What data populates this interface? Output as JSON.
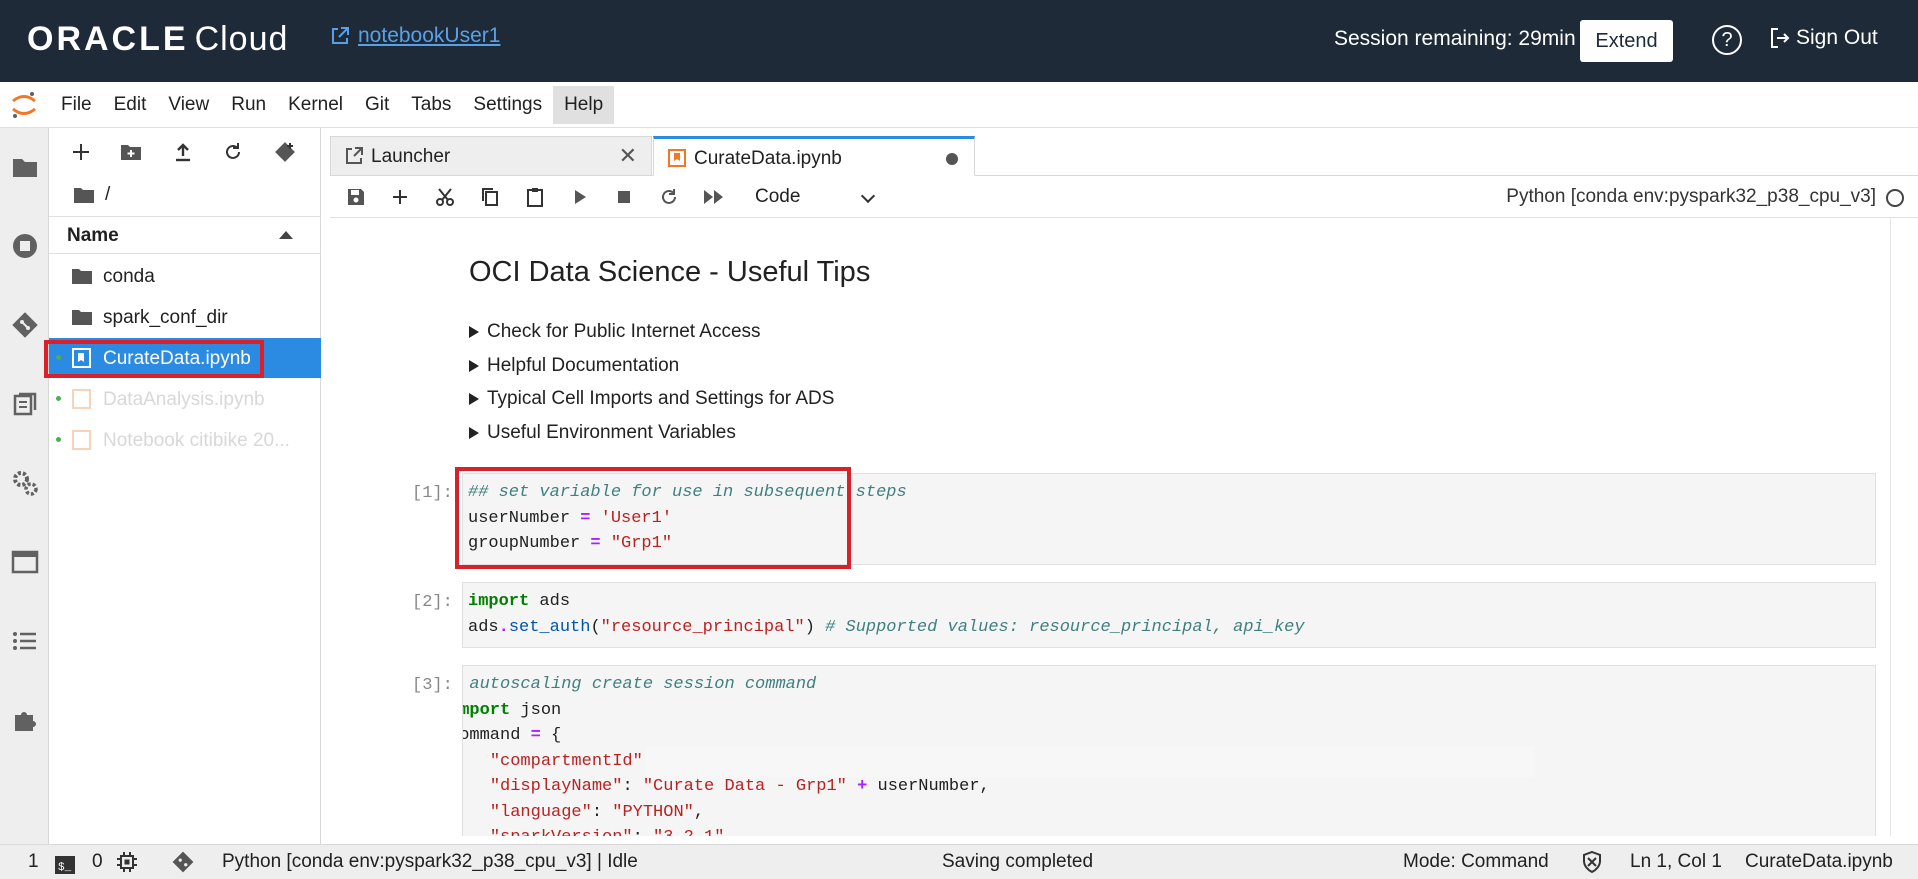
{
  "header": {
    "brand_bold": "ORACLE",
    "brand_light": "Cloud",
    "notebook_link": "notebookUser1",
    "session_text": "Session remaining: 29min",
    "extend_label": "Extend",
    "help_label": "?",
    "signout_label": "Sign Out",
    "bg_color": "#1f2a38"
  },
  "menubar": {
    "items": [
      "File",
      "Edit",
      "View",
      "Run",
      "Kernel",
      "Git",
      "Tabs",
      "Settings",
      "Help"
    ],
    "active": "Help"
  },
  "sidebar_icons": [
    "folder-icon",
    "running-icon",
    "git-icon",
    "property-inspector-icon",
    "settings-icon",
    "tabs-icon",
    "toc-icon",
    "extension-icon"
  ],
  "file_browser": {
    "breadcrumb": "/",
    "column_name": "Name",
    "rows": [
      {
        "name": "conda",
        "type": "folder"
      },
      {
        "name": "spark_conf_dir",
        "type": "folder"
      },
      {
        "name": "CurateData.ipynb",
        "type": "notebook",
        "selected": true
      },
      {
        "name": "DataAnalysis.ipynb",
        "type": "notebook"
      },
      {
        "name": "Notebook citibike 20...",
        "type": "notebook"
      }
    ]
  },
  "tabs": [
    {
      "label": "Launcher",
      "active": false
    },
    {
      "label": "CurateData.ipynb",
      "active": true
    }
  ],
  "nb_toolbar": {
    "cell_type": "Code",
    "kernel": "Python [conda env:pyspark32_p38_cpu_v3]"
  },
  "notebook": {
    "title": "OCI Data Science - Useful Tips",
    "details": [
      "Check for Public Internet Access",
      "Helpful Documentation",
      "Typical Cell Imports and Settings for ADS",
      "Useful Environment Variables"
    ],
    "cells": [
      {
        "prompt": "[1]:"
      },
      {
        "prompt": "[2]:"
      },
      {
        "prompt": "[3]:"
      }
    ]
  },
  "statusbar": {
    "count_terminals": "1",
    "count_kernels": "0",
    "kernel_status": "Python [conda env:pyspark32_p38_cpu_v3] | Idle",
    "save_status": "Saving completed",
    "mode": "Mode: Command",
    "cursor": "Ln 1, Col 1",
    "filename": "CurateData.ipynb"
  },
  "colors": {
    "accent": "#2b8be3",
    "highlight_red": "#d8212b",
    "notebook_orange": "#f37726"
  }
}
